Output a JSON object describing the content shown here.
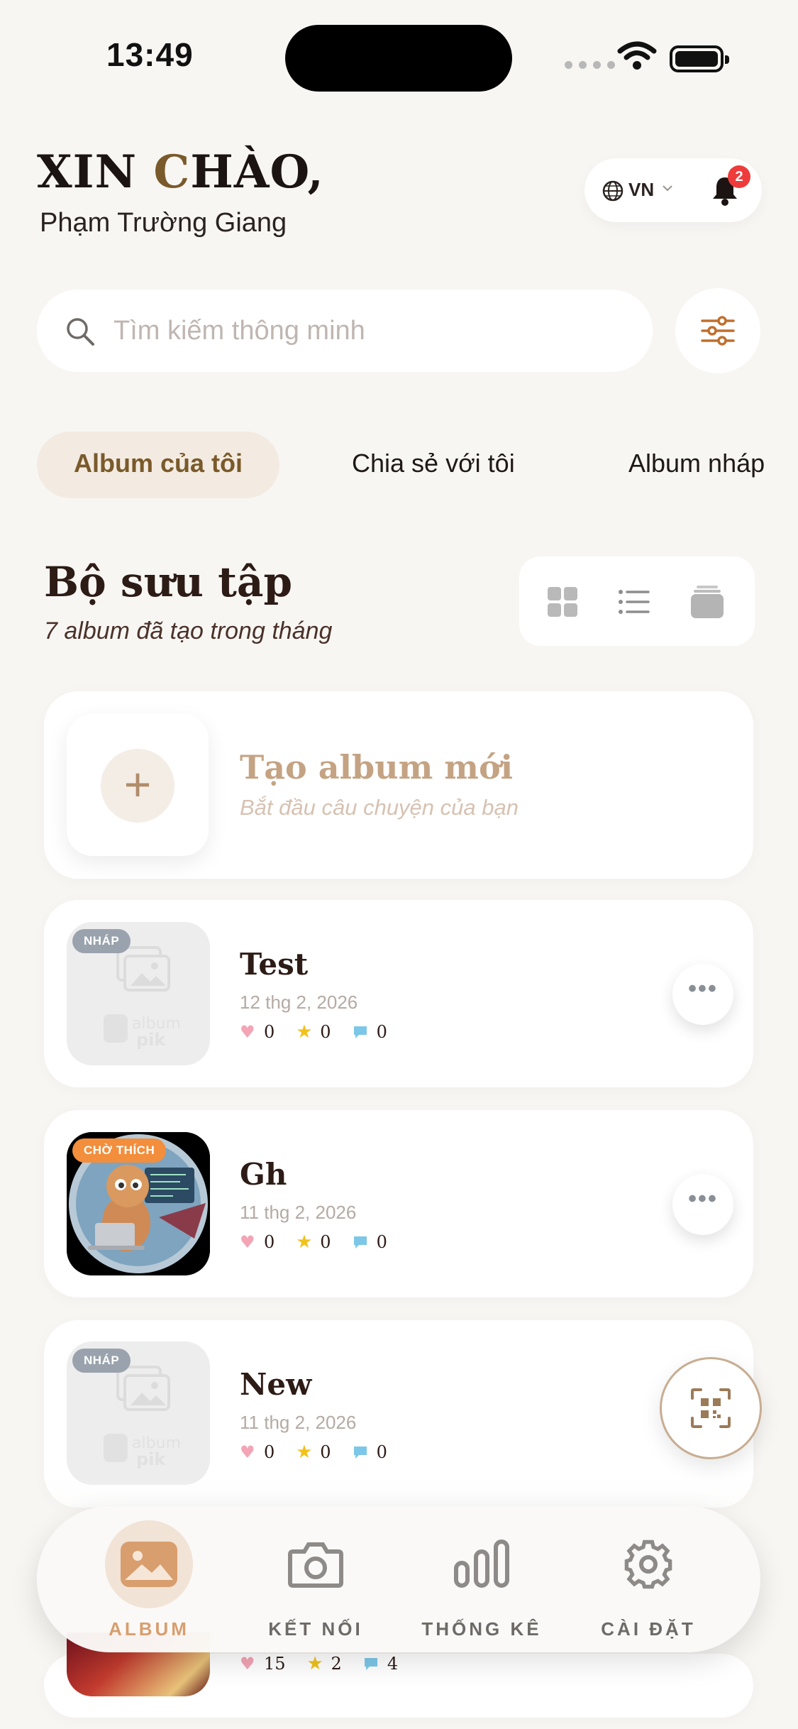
{
  "status_bar": {
    "time": "13:49"
  },
  "header": {
    "greeting_prefix": "XIN ",
    "greeting_accent": "C",
    "greeting_suffix": "HÀO,",
    "username": "Phạm Trường Giang",
    "language": "VN",
    "notification_count": "2"
  },
  "search": {
    "placeholder": "Tìm kiếm thông minh"
  },
  "tabs": [
    {
      "label": "Album của tôi",
      "active": true
    },
    {
      "label": "Chia sẻ với tôi",
      "active": false
    },
    {
      "label": "Album nháp",
      "active": false
    }
  ],
  "collection": {
    "title": "Bộ sưu tập",
    "subtitle": "7 album đã tạo trong tháng"
  },
  "create_album": {
    "plus": "+",
    "title": "Tạo album mới",
    "subtitle": "Bắt đầu câu chuyện của bạn"
  },
  "albums": [
    {
      "badge": "NHÁP",
      "name": "Test",
      "date": "12 thg 2, 2026",
      "likes": "0",
      "stars": "0",
      "comments": "0"
    },
    {
      "badge": "CHỜ THÍCH",
      "name": "Gh",
      "date": "11 thg 2, 2026",
      "likes": "0",
      "stars": "0",
      "comments": "0"
    },
    {
      "badge": "NHÁP",
      "name": "New",
      "date": "11 thg 2, 2026",
      "likes": "0",
      "stars": "0",
      "comments": "0"
    },
    {
      "likes": "15",
      "stars": "2",
      "comments": "4"
    }
  ],
  "more_label": "•••",
  "bottom_nav": [
    {
      "label": "ALBUM",
      "active": true
    },
    {
      "label": "KẾT NỐI",
      "active": false
    },
    {
      "label": "THỐNG KÊ",
      "active": false
    },
    {
      "label": "CÀI ĐẶT",
      "active": false
    }
  ],
  "colors": {
    "accent_brown": "#7a5a2b",
    "nav_active": "#d89e6e",
    "badge_draft": "#9aa3ad",
    "badge_favorite": "#f28e3c",
    "notification_red": "#ee3b3b"
  }
}
